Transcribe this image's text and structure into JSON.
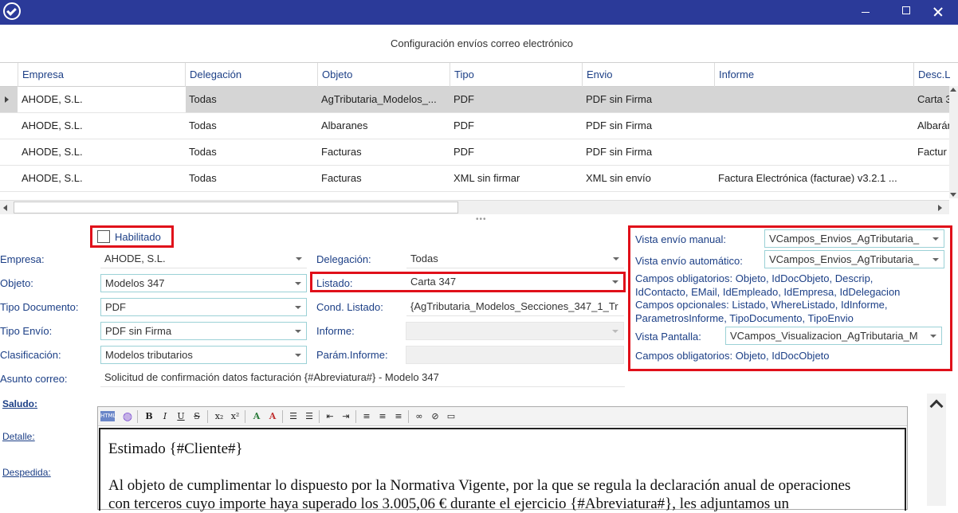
{
  "window": {
    "title": "Configuración envíos correo electrónico"
  },
  "grid": {
    "columns": [
      "Empresa",
      "Delegación",
      "Objeto",
      "Tipo",
      "Envio",
      "Informe",
      "Desc.Lis"
    ],
    "rows": [
      [
        "AHODE, S.L.",
        "Todas",
        "AgTributaria_Modelos_...",
        "PDF",
        "PDF sin Firma",
        "",
        "Carta 3"
      ],
      [
        "AHODE, S.L.",
        "Todas",
        "Albaranes",
        "PDF",
        "PDF sin Firma",
        "",
        "Albarán"
      ],
      [
        "AHODE, S.L.",
        "Todas",
        "Facturas",
        "PDF",
        "PDF sin Firma",
        "",
        "Factur"
      ],
      [
        "AHODE, S.L.",
        "Todas",
        "Facturas",
        "XML sin firmar",
        "XML sin envío",
        "Factura Electrónica (facturae) v3.2.1 ...",
        ""
      ]
    ]
  },
  "form": {
    "habilitado_label": "Habilitado",
    "empresa": {
      "label": "Empresa:",
      "value": "AHODE, S.L."
    },
    "delegacion": {
      "label": "Delegación:",
      "value": "Todas"
    },
    "objeto": {
      "label": "Objeto:",
      "value": "Modelos 347"
    },
    "listado": {
      "label": "Listado:",
      "value": "Carta 347"
    },
    "tipo_documento": {
      "label": "Tipo Documento:",
      "value": "PDF"
    },
    "cond_listado": {
      "label": "Cond. Listado:",
      "value": "{AgTributaria_Modelos_Secciones_347_1_Tr"
    },
    "tipo_envio": {
      "label": "Tipo Envío:",
      "value": "PDF sin Firma"
    },
    "informe": {
      "label": "Informe:",
      "value": ""
    },
    "clasificacion": {
      "label": "Clasificación:",
      "value": "Modelos tributarios"
    },
    "param_informe": {
      "label": "Parám.Informe:",
      "value": ""
    },
    "asunto": {
      "label": "Asunto correo:",
      "value": "Solicitud de confirmación datos facturación {#Abreviatura#} - Modelo 347"
    }
  },
  "side": {
    "vista_manual": {
      "label": "Vista envío manual:",
      "value": "VCampos_Envios_AgTributaria_"
    },
    "vista_auto": {
      "label": "Vista envío automático:",
      "value": "VCampos_Envios_AgTributaria_"
    },
    "campos_oblig_1": [
      "Campos obligatorios: Objeto, IdDocObjeto, Descrip,",
      "IdContacto, EMail, IdEmpleado, IdEmpresa, IdDelegacion"
    ],
    "campos_opc": [
      "Campos opcionales: Listado, WhereListado, IdInforme,",
      "ParametrosInforme, TipoDocumento, TipoEnvio"
    ],
    "vista_pantalla": {
      "label": "Vista Pantalla:",
      "value": "VCampos_Visualizacion_AgTributaria_M"
    },
    "campos_oblig_2": "Campos obligatorios: Objeto, IdDocObjeto"
  },
  "links": {
    "saludo": "Saludo:",
    "detalle": "Detalle:",
    "despedida": "Despedida:"
  },
  "editor": {
    "line1": "Estimado {#Cliente#}",
    "line2": "Al objeto de cumplimentar lo dispuesto por la Normativa Vigente, por la que se regula la declaración anual de operaciones",
    "line3": "con terceros cuyo importe haya superado los 3.005,06 € durante el ejercicio {#Abreviatura#}, les adjuntamos un"
  },
  "colors": {
    "titlebar": "#2b3a99",
    "highlight_border": "#e0101a",
    "label_blue": "#1c3f86"
  }
}
